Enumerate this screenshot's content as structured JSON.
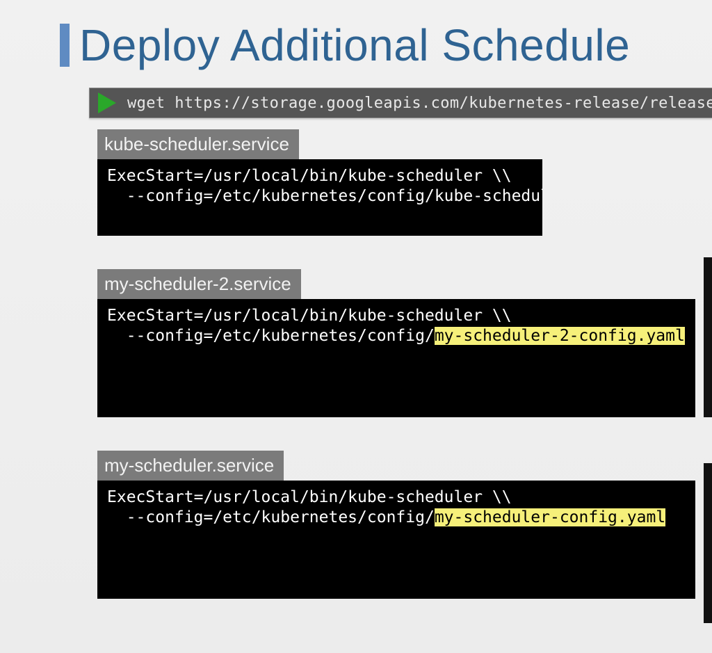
{
  "title": "Deploy Additional Schedule",
  "wget_command": "wget https://storage.googleapis.com/kubernetes-release/release/",
  "blocks": [
    {
      "label": "kube-scheduler.service",
      "line1": "ExecStart=/usr/local/bin/kube-scheduler \\\\",
      "line2_prefix": "  --config=/etc/kubernetes/config/",
      "line2_highlight": "",
      "line2_suffix": "kube-scheduler.yaml"
    },
    {
      "label": "my-scheduler-2.service",
      "line1": "ExecStart=/usr/local/bin/kube-scheduler \\\\",
      "line2_prefix": "  --config=/etc/kubernetes/config/",
      "line2_highlight": "my-scheduler-2-config.yaml",
      "line2_suffix": ""
    },
    {
      "label": "my-scheduler.service",
      "line1": "ExecStart=/usr/local/bin/kube-scheduler \\\\",
      "line2_prefix": "  --config=/etc/kubernetes/config/",
      "line2_highlight": "my-scheduler-config.yaml",
      "line2_suffix": ""
    }
  ]
}
